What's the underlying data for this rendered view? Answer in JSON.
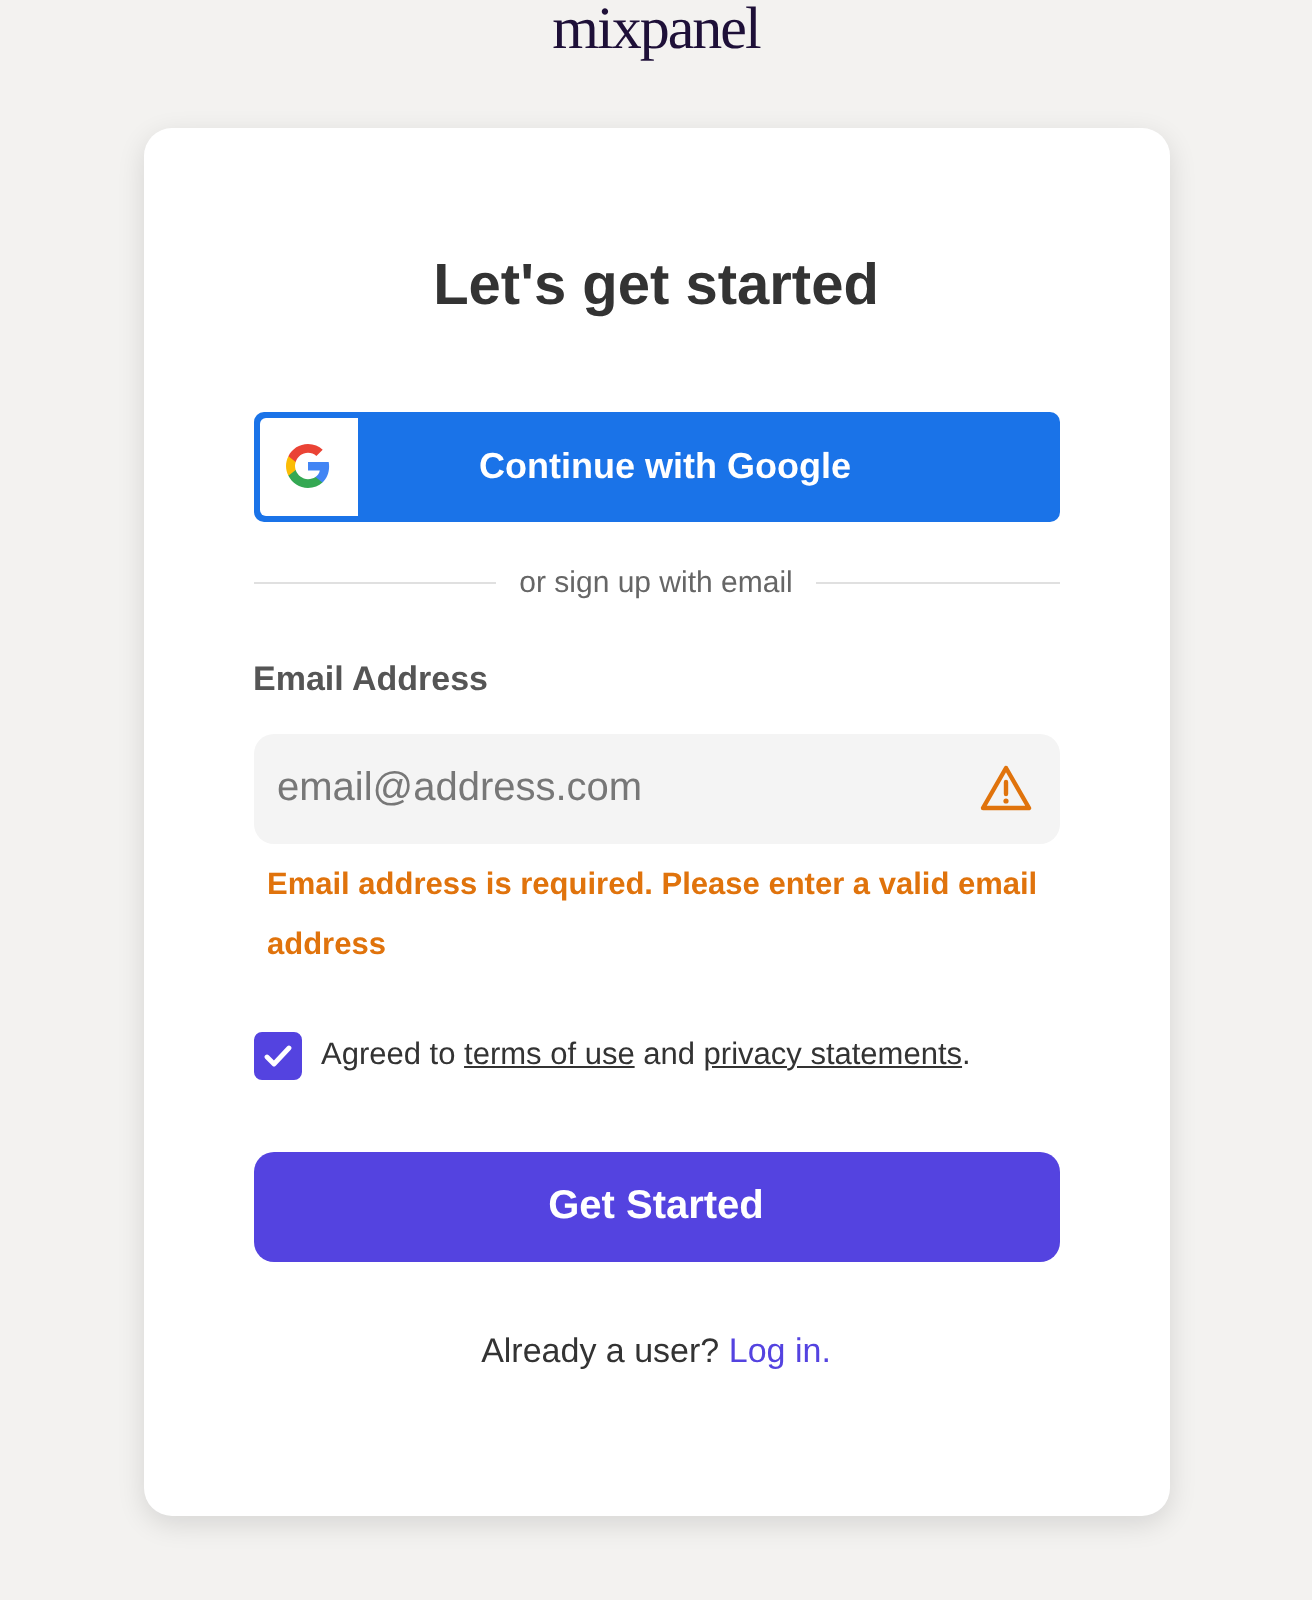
{
  "logo": "mixpanel",
  "title": "Let's get started",
  "google_button": "Continue with Google",
  "divider": "or sign up with email",
  "email": {
    "label": "Email Address",
    "placeholder": "email@address.com",
    "invalid": true,
    "error": "Email address is required. Please enter a valid email address"
  },
  "agreement": {
    "checked": true,
    "parts": [
      {
        "kind": "text",
        "text": "Agreed to "
      },
      {
        "kind": "link",
        "text": "terms of use"
      },
      {
        "kind": "text",
        "text": " and "
      },
      {
        "kind": "link",
        "text": "privacy statements"
      },
      {
        "kind": "text",
        "text": "."
      }
    ]
  },
  "submit_button": "Get Started",
  "footer": {
    "text": "Already a user?",
    "link": "Log in."
  }
}
